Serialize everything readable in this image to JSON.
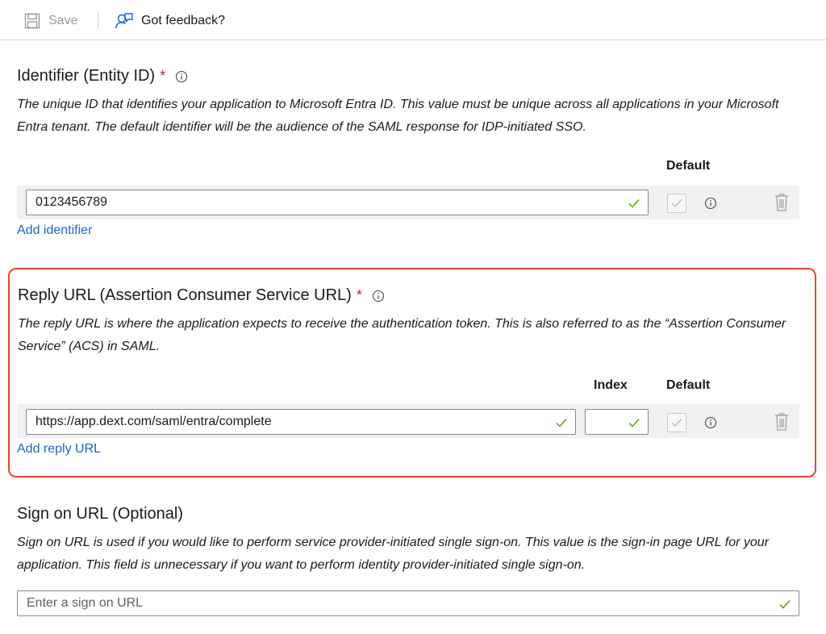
{
  "toolbar": {
    "save_label": "Save",
    "feedback_label": "Got feedback?"
  },
  "identifier": {
    "title": "Identifier (Entity ID)",
    "required_mark": "*",
    "description": "The unique ID that identifies your application to Microsoft Entra ID. This value must be unique across all applications in your Microsoft Entra tenant. The default identifier will be the audience of the SAML response for IDP-initiated SSO.",
    "default_header": "Default",
    "value": "0123456789",
    "add_link": "Add identifier"
  },
  "reply_url": {
    "title": "Reply URL (Assertion Consumer Service URL)",
    "required_mark": "*",
    "description": "The reply URL is where the application expects to receive the authentication token. This is also referred to as the “Assertion Consumer Service” (ACS) in SAML.",
    "index_header": "Index",
    "default_header": "Default",
    "value": "https://app.dext.com/saml/entra/complete",
    "index_value": "",
    "add_link": "Add reply URL"
  },
  "sign_on_url": {
    "title": "Sign on URL (Optional)",
    "description": "Sign on URL is used if you would like to perform service provider-initiated single sign-on. This value is the sign-in page URL for your application. This field is unnecessary if you want to perform identity provider-initiated single sign-on.",
    "placeholder": "Enter a sign on URL",
    "value": ""
  },
  "colors": {
    "link": "#1a66c7",
    "required": "#c4262e",
    "valid_check": "#57a300",
    "highlight_border": "#e5472f"
  }
}
